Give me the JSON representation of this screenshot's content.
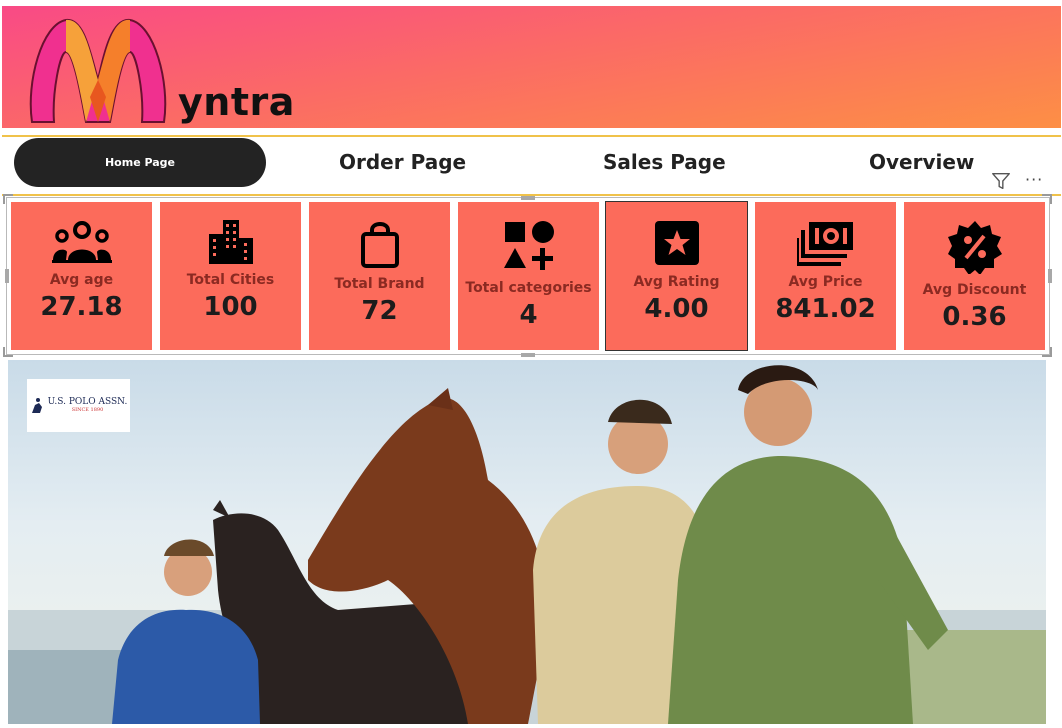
{
  "header": {
    "brand_name": "yntra",
    "logo": "myntra-m-logo",
    "colors": {
      "gradient_start": "#f94a86",
      "gradient_end": "#fd8f45"
    }
  },
  "nav": {
    "home_label": "Home Page",
    "order_label": "Order Page",
    "sales_label": "Sales Page",
    "overview_label": "Overview",
    "filter_icon": "filter-icon",
    "more_label": "···"
  },
  "kpis": [
    {
      "icon": "users-icon",
      "label": "Avg age",
      "value": "27.18"
    },
    {
      "icon": "buildings-icon",
      "label": "Total Cities",
      "value": "100"
    },
    {
      "icon": "shopping-bag-icon",
      "label": "Total Brand",
      "value": "72"
    },
    {
      "icon": "shapes-icon",
      "label": "Total categories",
      "value": "4"
    },
    {
      "icon": "star-icon",
      "label": "Avg Rating",
      "value": "4.00"
    },
    {
      "icon": "money-icon",
      "label": "Avg Price",
      "value": "841.02"
    },
    {
      "icon": "discount-badge-icon",
      "label": "Avg Discount",
      "value": "0.36"
    }
  ],
  "kpi_colors": {
    "card": "#fc6b5b",
    "label": "#8b2a22",
    "value": "#1c1c1c"
  },
  "hero": {
    "logo_text": "U.S. POLO ASSN.",
    "logo_sub": "SINCE 1890"
  }
}
